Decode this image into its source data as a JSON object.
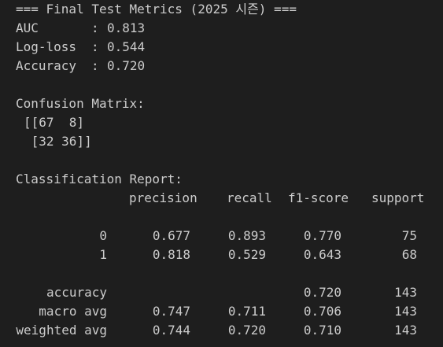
{
  "header": "=== Final Test Metrics (2025 시즌) ===",
  "metrics": [
    {
      "label": "AUC",
      "value": "0.813"
    },
    {
      "label": "Log-loss",
      "value": "0.544"
    },
    {
      "label": "Accuracy",
      "value": "0.720"
    }
  ],
  "confusion": {
    "title": "Confusion Matrix:",
    "rows": [
      "[[67  8]",
      " [32 36]]"
    ]
  },
  "report": {
    "title": "Classification Report:",
    "columns": [
      "precision",
      "recall",
      "f1-score",
      "support"
    ],
    "class_rows": [
      {
        "label": "0",
        "precision": "0.677",
        "recall": "0.893",
        "f1": "0.770",
        "support": "75"
      },
      {
        "label": "1",
        "precision": "0.818",
        "recall": "0.529",
        "f1": "0.643",
        "support": "68"
      }
    ],
    "summary_rows": [
      {
        "label": "accuracy",
        "precision": "",
        "recall": "",
        "f1": "0.720",
        "support": "143"
      },
      {
        "label": "macro avg",
        "precision": "0.747",
        "recall": "0.711",
        "f1": "0.706",
        "support": "143"
      },
      {
        "label": "weighted avg",
        "precision": "0.744",
        "recall": "0.720",
        "f1": "0.710",
        "support": "143"
      }
    ]
  }
}
